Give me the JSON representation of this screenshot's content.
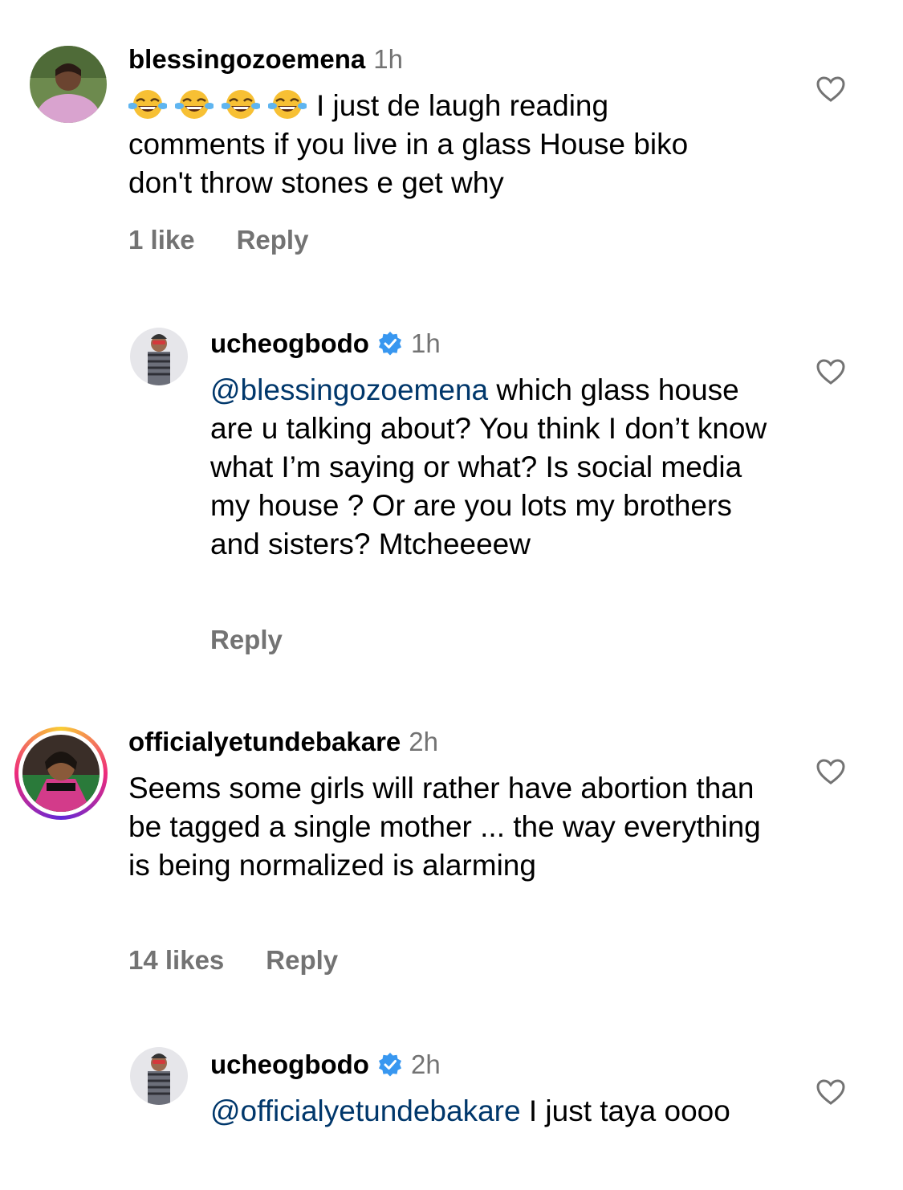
{
  "colors": {
    "text": "#000000",
    "secondary": "#737373",
    "mention": "#00376b",
    "verified": "#3897f0",
    "story_ring": [
      "#f9ce34",
      "#ee2a7b",
      "#6228d7"
    ]
  },
  "comments": [
    {
      "username": "blessingozoemena",
      "time": "1h",
      "verified": false,
      "emoji_prefix": [
        "face-with-tears-of-joy",
        "face-with-tears-of-joy",
        "face-with-tears-of-joy",
        "face-with-tears-of-joy"
      ],
      "text": "I just de laugh reading comments if you live in a glass House biko don't throw stones e get why",
      "likes": "1 like",
      "reply": "Reply"
    },
    {
      "username": "ucheogbodo",
      "time": "1h",
      "verified": true,
      "mention": "@blessingozoemena",
      "text": "which glass house are u talking about? You think I don’t know what I’m saying or what? Is social media my house ? Or are you lots my brothers and sisters? Mtcheeeew",
      "reply": "Reply"
    },
    {
      "username": "officialyetundebakare",
      "time": "2h",
      "verified": false,
      "has_story_ring": true,
      "text": "Seems some girls will rather have abortion than be tagged a single mother ... the way everything is being normalized is alarming",
      "likes": "14 likes",
      "reply": "Reply"
    },
    {
      "username": "ucheogbodo",
      "time": "2h",
      "verified": true,
      "mention": "@officialyetundebakare",
      "text": "I just taya oooo"
    }
  ]
}
